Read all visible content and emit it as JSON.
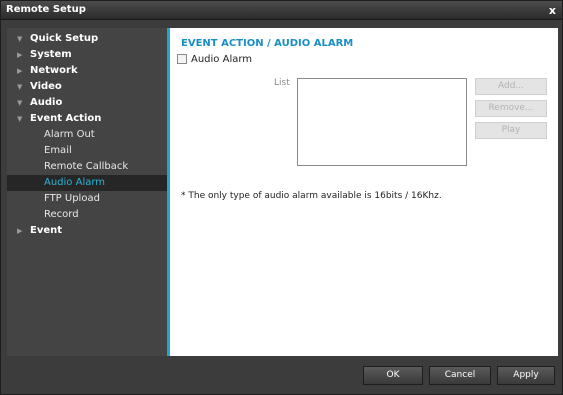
{
  "window": {
    "title": "Remote Setup",
    "close_label": "x"
  },
  "sidebar": {
    "items": [
      {
        "label": "Quick Setup",
        "expanded": true,
        "level": "top",
        "arrow": "▼"
      },
      {
        "label": "System",
        "expanded": false,
        "level": "top",
        "arrow": "▶"
      },
      {
        "label": "Network",
        "expanded": false,
        "level": "top",
        "arrow": "▶"
      },
      {
        "label": "Video",
        "expanded": true,
        "level": "top",
        "arrow": "▼"
      },
      {
        "label": "Audio",
        "expanded": true,
        "level": "top",
        "arrow": "▼"
      },
      {
        "label": "Event Action",
        "expanded": true,
        "level": "top",
        "arrow": "▼"
      },
      {
        "label": "Alarm Out",
        "level": "sub"
      },
      {
        "label": "Email",
        "level": "sub"
      },
      {
        "label": "Remote Callback",
        "level": "sub"
      },
      {
        "label": "Audio Alarm",
        "level": "sub",
        "selected": true
      },
      {
        "label": "FTP Upload",
        "level": "sub"
      },
      {
        "label": "Record",
        "level": "sub"
      },
      {
        "label": "Event",
        "expanded": false,
        "level": "top",
        "arrow": "▶"
      }
    ]
  },
  "main": {
    "section_title": "EVENT ACTION / AUDIO ALARM",
    "audio_alarm_checkbox": {
      "label": "Audio Alarm",
      "checked": false
    },
    "list_label": "List",
    "buttons": {
      "add": "Add...",
      "remove": "Remove...",
      "play": "Play"
    },
    "note": "* The only type of audio alarm available is 16bits / 16Khz."
  },
  "footer": {
    "ok": "OK",
    "cancel": "Cancel",
    "apply": "Apply"
  },
  "colors": {
    "accent": "#1fa6cf",
    "selected_text": "#2ab5d8",
    "title_text": "#1a8fc4"
  }
}
